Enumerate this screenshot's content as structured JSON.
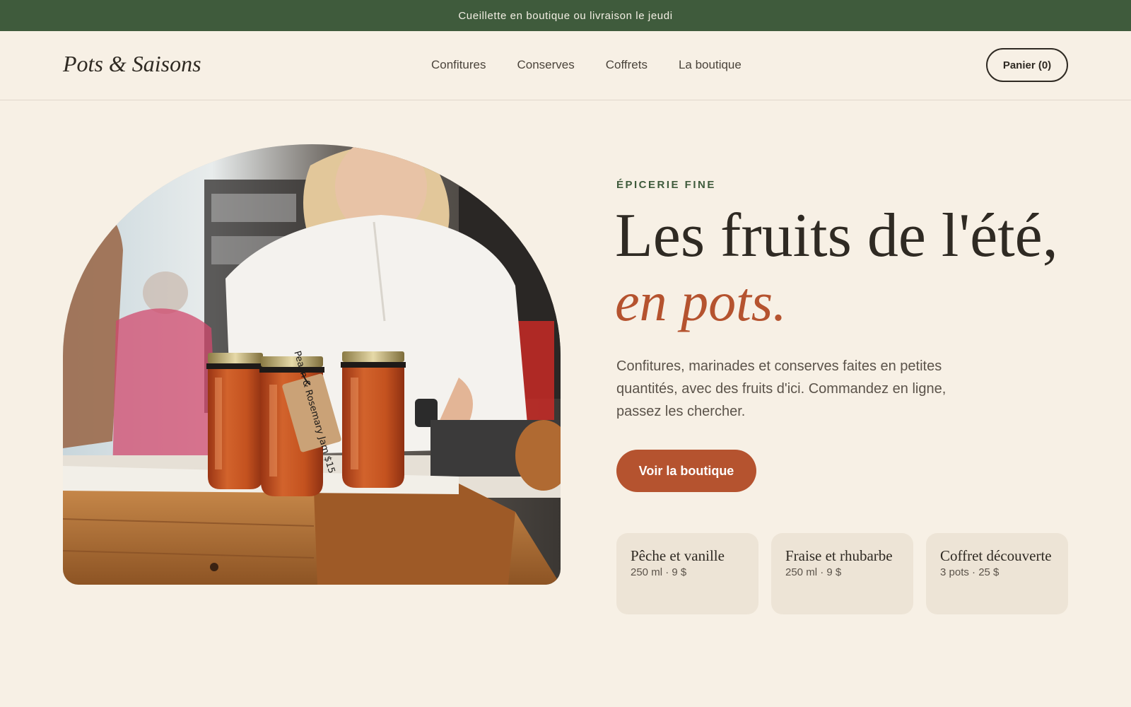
{
  "announcement": {
    "text": "Cueillette en boutique ou livraison le jeudi"
  },
  "header": {
    "logo": "Pots & Saisons",
    "nav": [
      {
        "label": "Confitures"
      },
      {
        "label": "Conserves"
      },
      {
        "label": "Coffrets"
      },
      {
        "label": "La boutique"
      }
    ],
    "cart_label": "Panier (0)"
  },
  "hero": {
    "eyebrow": "ÉPICERIE FINE",
    "headline_line1": "Les fruits de l'été,",
    "headline_line2": "en pots.",
    "description": "Confitures, marinades et conserves faites en petites quantités, avec des fruits d'ici. Commandez en ligne, passez les chercher.",
    "cta_label": "Voir la boutique",
    "image_tag_text": "Peach & Rosemary Jam $15"
  },
  "products": [
    {
      "name": "Pêche et vanille",
      "meta": "250 ml · 9 $"
    },
    {
      "name": "Fraise et rhubarbe",
      "meta": "250 ml · 9 $"
    },
    {
      "name": "Coffret découverte",
      "meta": "3 pots · 25 $"
    }
  ],
  "colors": {
    "background": "#f7f0e5",
    "announcement_bg": "#3f5b3c",
    "accent": "#b5532f",
    "card_bg": "#ede4d6",
    "text": "#2f2a23"
  }
}
